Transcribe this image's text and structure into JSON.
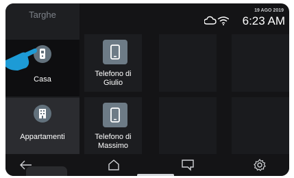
{
  "sidebar": {
    "title": "Targhe",
    "items": [
      {
        "label": "Casa",
        "icon": "intercom-icon",
        "active": true
      },
      {
        "label": "Appartamenti",
        "icon": "building-icon",
        "active": false
      }
    ]
  },
  "status": {
    "date": "19 AGO 2019",
    "time": "6:23 AM",
    "icons": [
      "cloud-icon",
      "wifi-icon"
    ]
  },
  "tiles": [
    {
      "label_line1": "Telefono di",
      "label_line2": "Giulio",
      "icon": "phone-icon"
    },
    {
      "label_line1": "Telefono di",
      "label_line2": "Massimo",
      "icon": "phone-icon"
    }
  ],
  "nav": {
    "icons": [
      "back-arrow-icon",
      "home-icon",
      "chat-icon",
      "settings-icon"
    ]
  },
  "colors": {
    "background": "#141416",
    "active_item": "#0e0e10",
    "inactive_item": "#2b2c30",
    "icon_badge": "#6d7b86",
    "hand_accent": "#1d9bd6"
  }
}
